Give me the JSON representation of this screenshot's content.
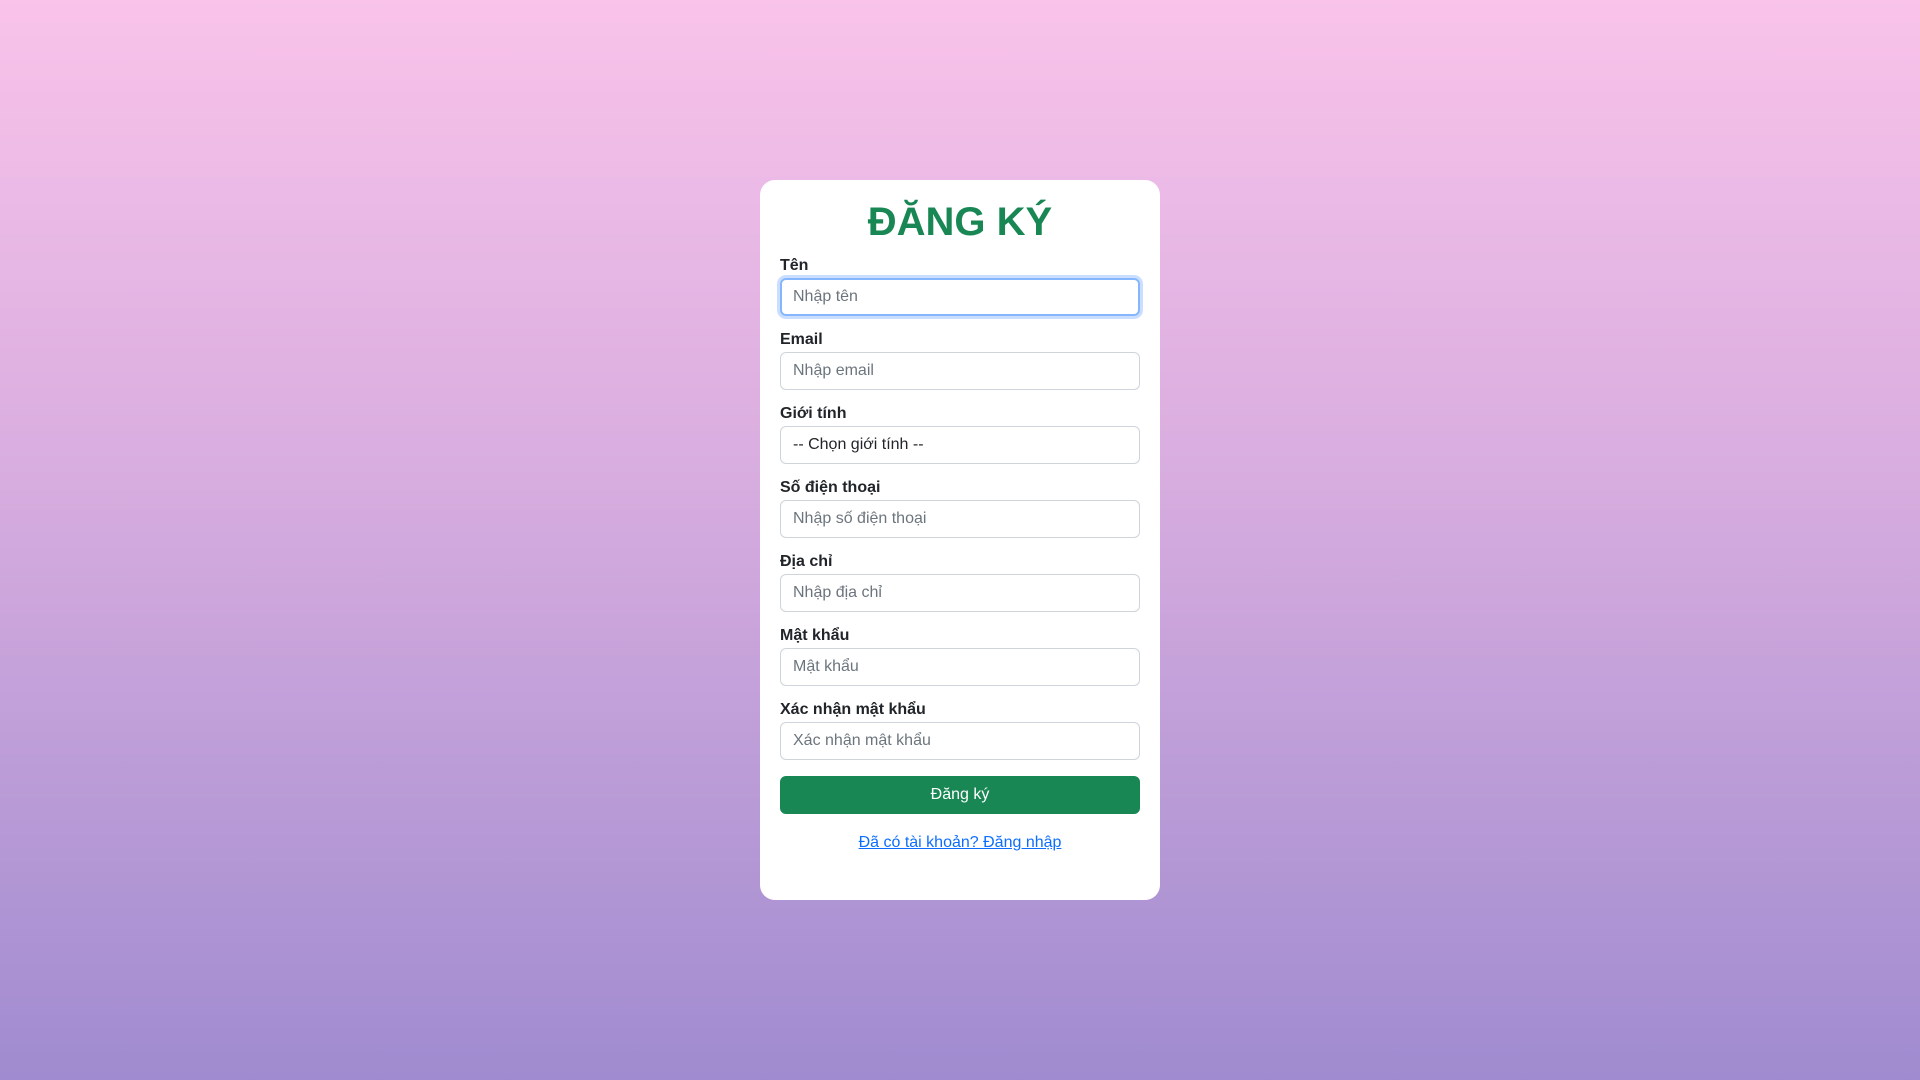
{
  "form": {
    "title": "ĐĂNG KÝ",
    "fields": [
      {
        "label": "Tên",
        "placeholder": "Nhập tên",
        "type": "text"
      },
      {
        "label": "Email",
        "placeholder": "Nhập email",
        "type": "email"
      },
      {
        "label": "Giới tính",
        "selected": "-- Chọn giới tính --",
        "type": "select"
      },
      {
        "label": "Số điện thoại",
        "placeholder": "Nhập số điện thoại",
        "type": "tel"
      },
      {
        "label": "Địa chỉ",
        "placeholder": "Nhập địa chỉ",
        "type": "text"
      },
      {
        "label": "Mật khẩu",
        "placeholder": "Mật khẩu",
        "type": "password"
      },
      {
        "label": "Xác nhận mật khẩu",
        "placeholder": "Xác nhận mật khẩu",
        "type": "password"
      }
    ],
    "submit_label": "Đăng ký",
    "login_link": "Đã có tài khoản? Đăng nhập"
  },
  "colors": {
    "accent": "#198754",
    "link": "#0d6efd",
    "background_top": "#f9c3ea",
    "background_bottom": "#a08bd0"
  }
}
